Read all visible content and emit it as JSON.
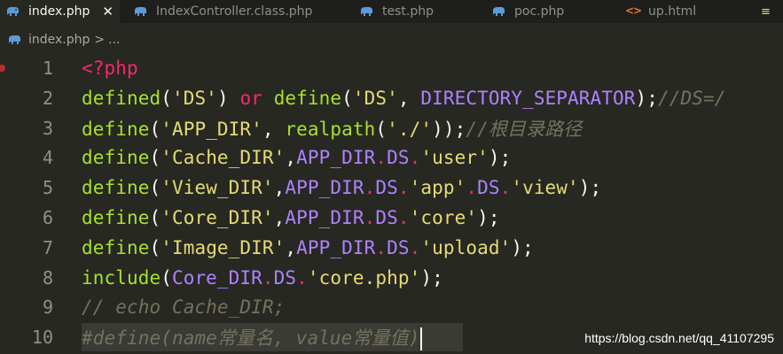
{
  "colors": {
    "background": "#272822",
    "tabbar_background": "#1e1f1c",
    "php_icon": "#5c9bd6",
    "html_icon": "#e37933",
    "breakpoint": "#c12b2b"
  },
  "tabs": [
    {
      "label": "index.php",
      "icon": "php-elephant-icon",
      "active": true,
      "closable": true
    },
    {
      "label": "IndexController.class.php",
      "icon": "php-elephant-icon",
      "active": false
    },
    {
      "label": "test.php",
      "icon": "php-elephant-icon",
      "active": false
    },
    {
      "label": "poc.php",
      "icon": "php-elephant-icon",
      "active": false
    },
    {
      "label": "up.html",
      "icon": "html-code-icon",
      "active": false
    }
  ],
  "breadcrumb": {
    "file": "index.php",
    "separator": ">",
    "more": "..."
  },
  "editor": {
    "breakpoint_line": 1,
    "cursor_line": 10,
    "lines": [
      {
        "number": "1",
        "tokens": [
          {
            "t": "tag",
            "v": "<?php"
          }
        ]
      },
      {
        "number": "2",
        "tokens": [
          {
            "t": "fn",
            "v": "defined"
          },
          {
            "t": "default",
            "v": "("
          },
          {
            "t": "str",
            "v": "'DS'"
          },
          {
            "t": "default",
            "v": ") "
          },
          {
            "t": "kw",
            "v": "or"
          },
          {
            "t": "default",
            "v": " "
          },
          {
            "t": "fn",
            "v": "define"
          },
          {
            "t": "default",
            "v": "("
          },
          {
            "t": "str",
            "v": "'DS'"
          },
          {
            "t": "default",
            "v": ", "
          },
          {
            "t": "const",
            "v": "DIRECTORY_SEPARATOR"
          },
          {
            "t": "default",
            "v": ");"
          },
          {
            "t": "comment",
            "v": "//DS=/"
          }
        ]
      },
      {
        "number": "3",
        "tokens": [
          {
            "t": "fn",
            "v": "define"
          },
          {
            "t": "default",
            "v": "("
          },
          {
            "t": "str",
            "v": "'APP_DIR'"
          },
          {
            "t": "default",
            "v": ", "
          },
          {
            "t": "fn",
            "v": "realpath"
          },
          {
            "t": "default",
            "v": "("
          },
          {
            "t": "str",
            "v": "'./'"
          },
          {
            "t": "default",
            "v": "));"
          },
          {
            "t": "comment",
            "v": "//根目录路径"
          }
        ]
      },
      {
        "number": "4",
        "tokens": [
          {
            "t": "fn",
            "v": "define"
          },
          {
            "t": "default",
            "v": "("
          },
          {
            "t": "str",
            "v": "'Cache_DIR'"
          },
          {
            "t": "default",
            "v": ","
          },
          {
            "t": "const",
            "v": "APP_DIR"
          },
          {
            "t": "kw",
            "v": "."
          },
          {
            "t": "const",
            "v": "DS"
          },
          {
            "t": "kw",
            "v": "."
          },
          {
            "t": "str",
            "v": "'user'"
          },
          {
            "t": "default",
            "v": ");"
          }
        ]
      },
      {
        "number": "5",
        "tokens": [
          {
            "t": "fn",
            "v": "define"
          },
          {
            "t": "default",
            "v": "("
          },
          {
            "t": "str",
            "v": "'View_DIR'"
          },
          {
            "t": "default",
            "v": ","
          },
          {
            "t": "const",
            "v": "APP_DIR"
          },
          {
            "t": "kw",
            "v": "."
          },
          {
            "t": "const",
            "v": "DS"
          },
          {
            "t": "kw",
            "v": "."
          },
          {
            "t": "str",
            "v": "'app'"
          },
          {
            "t": "kw",
            "v": "."
          },
          {
            "t": "const",
            "v": "DS"
          },
          {
            "t": "kw",
            "v": "."
          },
          {
            "t": "str",
            "v": "'view'"
          },
          {
            "t": "default",
            "v": ");"
          }
        ]
      },
      {
        "number": "6",
        "tokens": [
          {
            "t": "fn",
            "v": "define"
          },
          {
            "t": "default",
            "v": "("
          },
          {
            "t": "str",
            "v": "'Core_DIR'"
          },
          {
            "t": "default",
            "v": ","
          },
          {
            "t": "const",
            "v": "APP_DIR"
          },
          {
            "t": "kw",
            "v": "."
          },
          {
            "t": "const",
            "v": "DS"
          },
          {
            "t": "kw",
            "v": "."
          },
          {
            "t": "str",
            "v": "'core'"
          },
          {
            "t": "default",
            "v": ");"
          }
        ]
      },
      {
        "number": "7",
        "tokens": [
          {
            "t": "fn",
            "v": "define"
          },
          {
            "t": "default",
            "v": "("
          },
          {
            "t": "str",
            "v": "'Image_DIR'"
          },
          {
            "t": "default",
            "v": ","
          },
          {
            "t": "const",
            "v": "APP_DIR"
          },
          {
            "t": "kw",
            "v": "."
          },
          {
            "t": "const",
            "v": "DS"
          },
          {
            "t": "kw",
            "v": "."
          },
          {
            "t": "str",
            "v": "'upload'"
          },
          {
            "t": "default",
            "v": ");"
          }
        ]
      },
      {
        "number": "8",
        "tokens": [
          {
            "t": "fn",
            "v": "include"
          },
          {
            "t": "default",
            "v": "("
          },
          {
            "t": "const",
            "v": "Core_DIR"
          },
          {
            "t": "kw",
            "v": "."
          },
          {
            "t": "const",
            "v": "DS"
          },
          {
            "t": "kw",
            "v": "."
          },
          {
            "t": "str",
            "v": "'core.php'"
          },
          {
            "t": "default",
            "v": ");"
          }
        ]
      },
      {
        "number": "9",
        "tokens": [
          {
            "t": "comment",
            "v": "// echo Cache_DIR;"
          }
        ]
      },
      {
        "number": "10",
        "tokens": [
          {
            "t": "comment",
            "v": "#define(name常量名, value常量值)"
          }
        ]
      }
    ]
  },
  "watermark": "https://blog.csdn.net/qq_41107295"
}
